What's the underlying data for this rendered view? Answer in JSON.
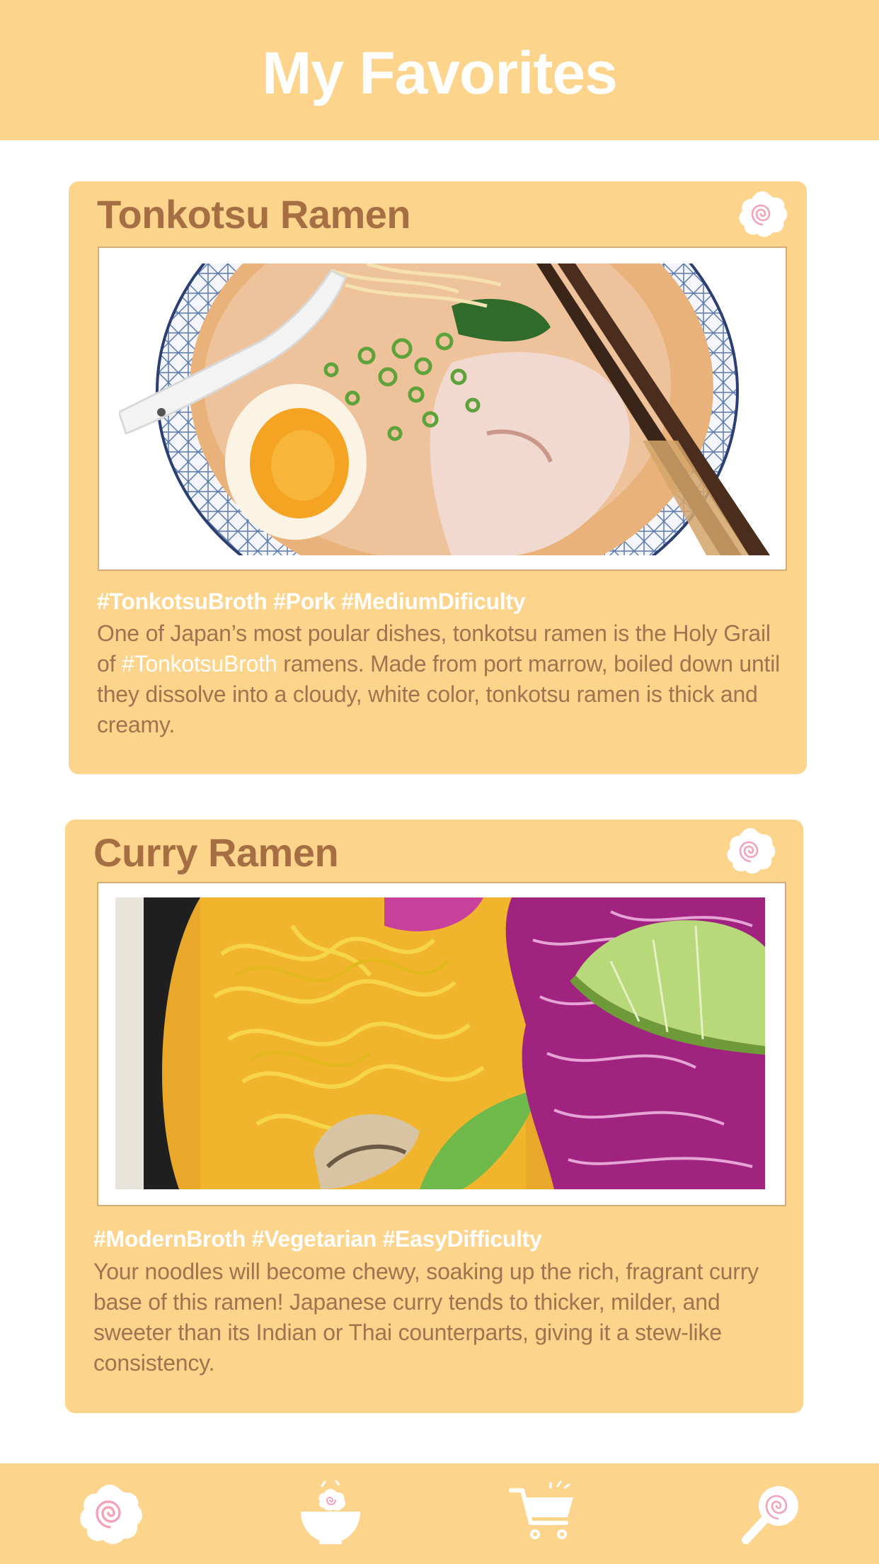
{
  "header": {
    "title": "My Favorites"
  },
  "cards": [
    {
      "title": "Tonkotsu Ramen",
      "favorite_icon": "naruto-fishcake-icon",
      "photo": "tonkotsu-ramen-photo",
      "tags": "#TonkotsuBroth #Pork #MediumDificulty",
      "description_part1": "One of Japan’s most poular dishes, tonkotsu ramen is the Holy Grail of ",
      "description_highlight": "#TonkotsuBroth",
      "description_part2": " ramens. Made from port marrow, boiled down until they dissolve into a cloudy, white color, tonkotsu ramen is thick and creamy."
    },
    {
      "title": "Curry Ramen",
      "favorite_icon": "naruto-fishcake-icon",
      "photo": "curry-ramen-photo",
      "tags": "#ModernBroth #Vegetarian #EasyDifficulty",
      "description": "Your noodles will become chewy, soaking up the  rich, fragrant curry base of this ramen!  Japanese curry tends to thicker, milder, and sweeter than its Indian or Thai counterparts, giving it a stew-like consistency."
    }
  ],
  "nav": [
    {
      "icon": "naruto-favorites-icon"
    },
    {
      "icon": "ramen-bowl-icon"
    },
    {
      "icon": "shopping-cart-icon"
    },
    {
      "icon": "search-magnifier-icon"
    }
  ],
  "colors": {
    "accent": "#fdd48b",
    "title": "#a56f43",
    "body_text": "#a0744f",
    "white": "#ffffff",
    "naruto_swirl": "#f2a3b8"
  }
}
